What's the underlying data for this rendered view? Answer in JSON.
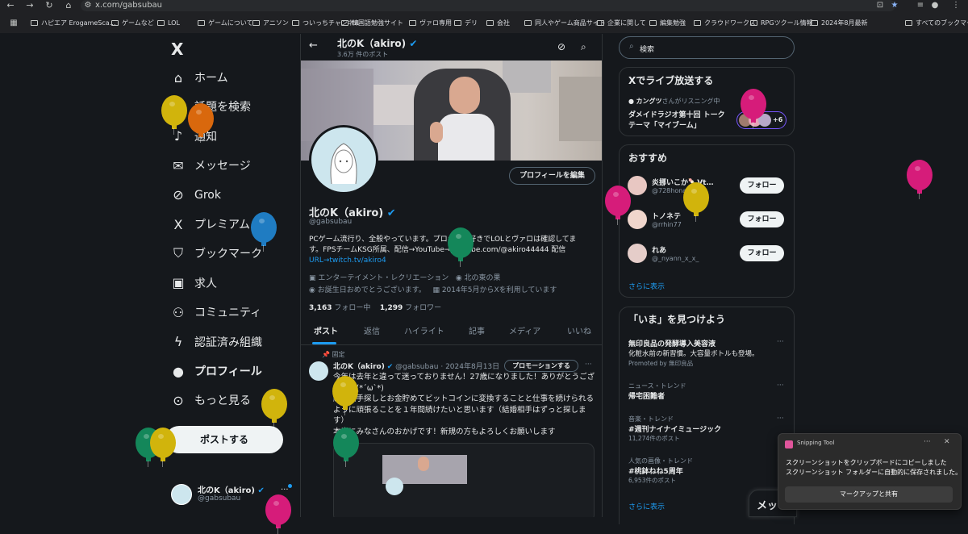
{
  "browser": {
    "url": "x.com/gabsubau",
    "bookmarks": [
      "ハピエア ErogameSca…",
      "ゲームなど",
      "LOL",
      "ゲームについて",
      "アニソン",
      "ついっちチャンネル",
      "韓国語勉強サイト",
      "ヴァロ専用",
      "デリ",
      "会社",
      "同人やゲーム商品サイト",
      "企業に関して",
      "編集勉強",
      "クラウドワークス",
      "RPGツクール情報",
      "2024年8月最新"
    ],
    "all_bookmarks": "すべてのブックマーク"
  },
  "nav": {
    "logo": "X",
    "items": [
      {
        "label": "ホーム",
        "icon": "home-icon"
      },
      {
        "label": "話題を検索",
        "icon": "search-icon"
      },
      {
        "label": "通知",
        "icon": "bell-icon"
      },
      {
        "label": "メッセージ",
        "icon": "mail-icon"
      },
      {
        "label": "Grok",
        "icon": "grok-icon"
      },
      {
        "label": "プレミアム",
        "icon": "x-logo-icon"
      },
      {
        "label": "ブックマーク",
        "icon": "bookmark-icon"
      },
      {
        "label": "求人",
        "icon": "briefcase-icon"
      },
      {
        "label": "コミュニティ",
        "icon": "community-icon"
      },
      {
        "label": "認証済み組織",
        "icon": "lightning-icon"
      },
      {
        "label": "プロフィール",
        "icon": "person-icon"
      },
      {
        "label": "もっと見る",
        "icon": "more-circle-icon"
      }
    ],
    "post_button": "ポストする",
    "account_name": "北のK（akiro)",
    "account_handle": "@gabsubau"
  },
  "profile": {
    "header_name": "北のK（akiro)",
    "post_count": "3.6万 件のポスト",
    "edit_button": "プロフィールを編集",
    "name": "北のK（akiro)",
    "handle": "@gabsubau",
    "bio_lines": [
      "PCゲーム流行り、全般やっています。プロシーン好きでLOLとヴァロは確認してま",
      "す。FPSチームKSG所属、配信→YouTube→youtube.com/@akiro44444 配信",
      "URL→twitch.tv/akiro4"
    ],
    "category": "エンターテイメント・レクリエーション",
    "location": "北の東の果",
    "birthday": "お誕生日おめでとうございます。",
    "joined": "2014年5月からXを利用しています",
    "following_count": "3,163",
    "following_label": "フォロー中",
    "followers_count": "1,299",
    "followers_label": "フォロワー",
    "tabs": [
      "ポスト",
      "返信",
      "ハイライト",
      "記事",
      "メディア",
      "いいね"
    ]
  },
  "post": {
    "pinned_label": "固定",
    "name": "北のK（akiro)",
    "handle": "@gabsubau",
    "date": "2024年8月13日",
    "promote_button": "プロモーションする",
    "lines": [
      "今年は去年と違って迷っておりません！27歳になりました！ありがとうござ",
      "います(*´ω`*)",
      "結婚相手探しとお金貯めてビットコインに変換することと仕事を続けられる",
      "ように頑張ることを１年間続けたいと思います（結婚相手はずっと探しま",
      "す）",
      "本当にみなさんのおかげです！新規の方もよろしくお願いします"
    ]
  },
  "right": {
    "search_placeholder": "検索",
    "live": {
      "title": "Xでライブ放送する",
      "host": "カングツ",
      "host_suffix": "さんがリスニング中",
      "space_title": "ダメイドラジオ第十回 トーク",
      "space_title2": "テーマ「マイブーム」",
      "extra": "+6"
    },
    "suggestions": {
      "title": "おすすめ",
      "follow_label": "フォロー",
      "items": [
        {
          "name": "炎挪いこか🍡Vt…",
          "handle": "@728honakok"
        },
        {
          "name": "トノネテ",
          "handle": "@rrhin77"
        },
        {
          "name": "れあ",
          "handle": "@_nyann_x_x_"
        }
      ],
      "more": "さらに表示"
    },
    "trends": {
      "title": "「いま」を見つけよう",
      "items": [
        {
          "context": "",
          "name": "無印良品の発酵導入美容液",
          "desc": "化粧水前の新習慣。大容量ボトルも登場。",
          "meta": "Promoted by 無印良品"
        },
        {
          "context": "ニュース・トレンド",
          "name": "帰宅困難者",
          "desc": "",
          "meta": ""
        },
        {
          "context": "音楽・トレンド",
          "name": "#週刊ナイナイミュージック",
          "desc": "",
          "meta": "11,274件のポスト"
        },
        {
          "context": "人気の画像・トレンド",
          "name": "#桃鉢ねね5周年",
          "desc": "",
          "meta": "6,953件のポスト"
        }
      ],
      "more": "さらに表示"
    },
    "messages_label": "メッ"
  },
  "toast": {
    "app": "Snipping Tool",
    "line1": "スクリーンショットをクリップボードにコピーしました",
    "line2": "スクリーンショット フォルダーに自動的に保存されました。",
    "action": "マークアップと共有"
  },
  "colors": {
    "background": "#15181c",
    "accent": "#1d9bf0",
    "verified": "#1d9bf0",
    "border": "#2f3336",
    "muted": "#8b98a5"
  }
}
